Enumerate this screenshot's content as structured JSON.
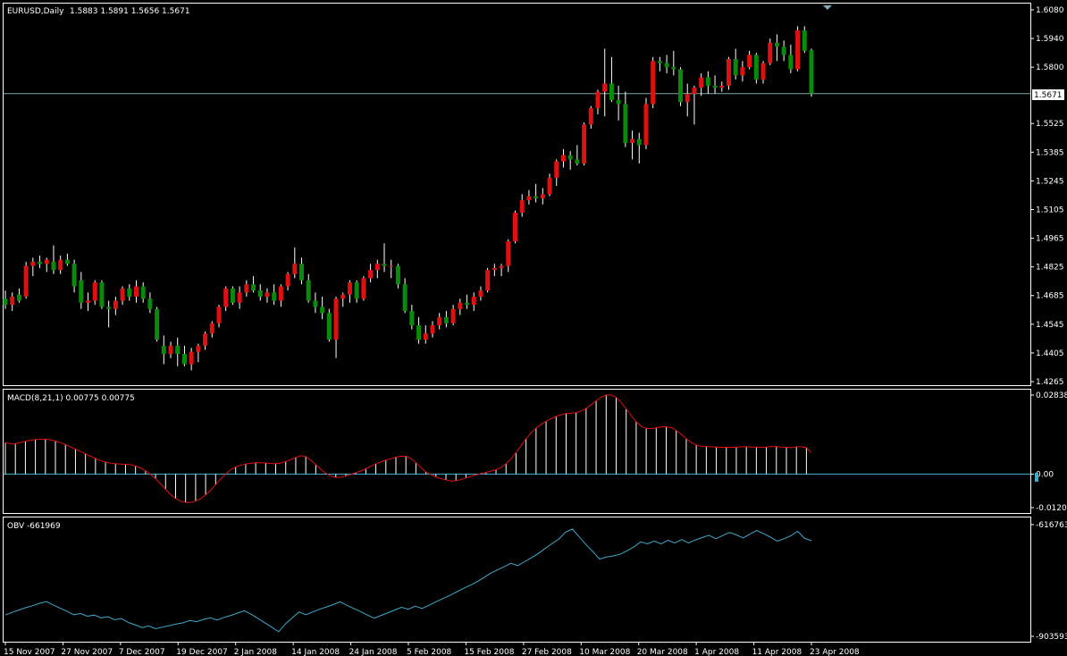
{
  "window": {
    "symbol_title": "EURUSD,Daily",
    "ohlc_readout": "1.5883 1.5891 1.5656 1.5671"
  },
  "colors": {
    "background": "#000000",
    "frame": "#ffffff",
    "bull_candle": "#0a8a0a",
    "bear_candle": "#e01010",
    "wick": "#ffffff",
    "price_line": "#7fa8a8",
    "macd_hist": "#ffffff",
    "macd_signal": "#e01010",
    "zero_line": "#3fa9c9",
    "obv_line": "#3fa9c9"
  },
  "price_panel": {
    "current_price_label": "1.5671",
    "y_ticks": [
      "1.6080",
      "1.5940",
      "1.5800",
      "1.5671",
      "1.5525",
      "1.5385",
      "1.5245",
      "1.5105",
      "1.4965",
      "1.4825",
      "1.4685",
      "1.4545",
      "1.4405",
      "1.4265"
    ]
  },
  "macd_panel": {
    "title": "MACD(8,21,1) 0.00775 0.00775",
    "y_ticks": [
      "0.02838",
      "0.00",
      "-0.01204"
    ]
  },
  "obv_panel": {
    "title": "OBV -661969",
    "y_ticks": [
      "-616763",
      "-903593"
    ]
  },
  "x_axis": {
    "labels": [
      "15 Nov 2007",
      "27 Nov 2007",
      "7 Dec 2007",
      "19 Dec 2007",
      "2 Jan 2008",
      "14 Jan 2008",
      "24 Jan 2008",
      "5 Feb 2008",
      "15 Feb 2008",
      "27 Feb 2008",
      "10 Mar 2008",
      "20 Mar 2008",
      "1 Apr 2008",
      "11 Apr 2008",
      "23 Apr 2008"
    ]
  },
  "chart_data": [
    {
      "type": "candlestick",
      "title": "EURUSD,Daily",
      "ylim": [
        1.4265,
        1.608
      ],
      "current_price": 1.5671,
      "candles": [
        [
          1.467,
          1.471,
          1.462,
          1.464
        ],
        [
          1.464,
          1.47,
          1.461,
          1.468
        ],
        [
          1.469,
          1.472,
          1.465,
          1.466
        ],
        [
          1.468,
          1.485,
          1.467,
          1.483
        ],
        [
          1.483,
          1.487,
          1.478,
          1.485
        ],
        [
          1.485,
          1.488,
          1.482,
          1.484
        ],
        [
          1.484,
          1.487,
          1.48,
          1.486
        ],
        [
          1.485,
          1.493,
          1.479,
          1.481
        ],
        [
          1.481,
          1.488,
          1.479,
          1.486
        ],
        [
          1.486,
          1.489,
          1.483,
          1.484
        ],
        [
          1.484,
          1.486,
          1.47,
          1.473
        ],
        [
          1.476,
          1.48,
          1.462,
          1.465
        ],
        [
          1.465,
          1.47,
          1.461,
          1.466
        ],
        [
          1.466,
          1.476,
          1.464,
          1.475
        ],
        [
          1.475,
          1.476,
          1.462,
          1.463
        ],
        [
          1.463,
          1.466,
          1.453,
          1.462
        ],
        [
          1.462,
          1.468,
          1.459,
          1.466
        ],
        [
          1.466,
          1.473,
          1.464,
          1.472
        ],
        [
          1.472,
          1.474,
          1.466,
          1.468
        ],
        [
          1.468,
          1.476,
          1.465,
          1.473
        ],
        [
          1.473,
          1.475,
          1.465,
          1.467
        ],
        [
          1.467,
          1.47,
          1.46,
          1.462
        ],
        [
          1.462,
          1.463,
          1.446,
          1.447
        ],
        [
          1.444,
          1.449,
          1.435,
          1.44
        ],
        [
          1.44,
          1.446,
          1.438,
          1.444
        ],
        [
          1.444,
          1.448,
          1.434,
          1.44
        ],
        [
          1.44,
          1.444,
          1.434,
          1.435
        ],
        [
          1.435,
          1.443,
          1.432,
          1.441
        ],
        [
          1.441,
          1.445,
          1.436,
          1.444
        ],
        [
          1.444,
          1.451,
          1.442,
          1.45
        ],
        [
          1.45,
          1.456,
          1.448,
          1.455
        ],
        [
          1.455,
          1.464,
          1.453,
          1.463
        ],
        [
          1.463,
          1.473,
          1.461,
          1.472
        ],
        [
          1.472,
          1.473,
          1.464,
          1.465
        ],
        [
          1.465,
          1.473,
          1.462,
          1.47
        ],
        [
          1.47,
          1.476,
          1.468,
          1.474
        ],
        [
          1.474,
          1.478,
          1.47,
          1.471
        ],
        [
          1.471,
          1.474,
          1.466,
          1.468
        ],
        [
          1.468,
          1.472,
          1.465,
          1.47
        ],
        [
          1.47,
          1.474,
          1.464,
          1.466
        ],
        [
          1.466,
          1.474,
          1.463,
          1.473
        ],
        [
          1.473,
          1.48,
          1.471,
          1.479
        ],
        [
          1.479,
          1.492,
          1.477,
          1.484
        ],
        [
          1.484,
          1.487,
          1.474,
          1.476
        ],
        [
          1.476,
          1.479,
          1.465,
          1.466
        ],
        [
          1.466,
          1.47,
          1.46,
          1.463
        ],
        [
          1.463,
          1.468,
          1.457,
          1.46
        ],
        [
          1.46,
          1.462,
          1.446,
          1.447
        ],
        [
          1.447,
          1.468,
          1.438,
          1.467
        ],
        [
          1.467,
          1.47,
          1.463,
          1.469
        ],
        [
          1.469,
          1.476,
          1.465,
          1.475
        ],
        [
          1.475,
          1.476,
          1.465,
          1.467
        ],
        [
          1.467,
          1.478,
          1.466,
          1.477
        ],
        [
          1.477,
          1.484,
          1.475,
          1.481
        ],
        [
          1.481,
          1.486,
          1.477,
          1.484
        ],
        [
          1.484,
          1.494,
          1.48,
          1.483
        ],
        [
          1.483,
          1.486,
          1.477,
          1.483
        ],
        [
          1.483,
          1.484,
          1.472,
          1.474
        ],
        [
          1.474,
          1.477,
          1.46,
          1.461
        ],
        [
          1.461,
          1.464,
          1.452,
          1.454
        ],
        [
          1.454,
          1.458,
          1.445,
          1.447
        ],
        [
          1.447,
          1.454,
          1.445,
          1.45
        ],
        [
          1.45,
          1.456,
          1.448,
          1.454
        ],
        [
          1.454,
          1.46,
          1.452,
          1.458
        ],
        [
          1.458,
          1.461,
          1.453,
          1.455
        ],
        [
          1.455,
          1.464,
          1.454,
          1.462
        ],
        [
          1.462,
          1.467,
          1.459,
          1.465
        ],
        [
          1.465,
          1.469,
          1.462,
          1.464
        ],
        [
          1.464,
          1.47,
          1.461,
          1.468
        ],
        [
          1.468,
          1.473,
          1.466,
          1.471
        ],
        [
          1.471,
          1.482,
          1.47,
          1.481
        ],
        [
          1.481,
          1.484,
          1.478,
          1.482
        ],
        [
          1.482,
          1.484,
          1.478,
          1.483
        ],
        [
          1.483,
          1.496,
          1.48,
          1.495
        ],
        [
          1.495,
          1.51,
          1.494,
          1.509
        ],
        [
          1.509,
          1.518,
          1.507,
          1.515
        ],
        [
          1.515,
          1.52,
          1.513,
          1.517
        ],
        [
          1.517,
          1.523,
          1.514,
          1.516
        ],
        [
          1.516,
          1.521,
          1.513,
          1.518
        ],
        [
          1.518,
          1.528,
          1.517,
          1.526
        ],
        [
          1.526,
          1.535,
          1.522,
          1.534
        ],
        [
          1.534,
          1.54,
          1.531,
          1.537
        ],
        [
          1.537,
          1.539,
          1.53,
          1.535
        ],
        [
          1.535,
          1.542,
          1.532,
          1.533
        ],
        [
          1.533,
          1.553,
          1.532,
          1.552
        ],
        [
          1.552,
          1.561,
          1.55,
          1.56
        ],
        [
          1.56,
          1.569,
          1.557,
          1.568
        ],
        [
          1.568,
          1.589,
          1.556,
          1.572
        ],
        [
          1.572,
          1.585,
          1.563,
          1.564
        ],
        [
          1.564,
          1.571,
          1.554,
          1.562
        ],
        [
          1.562,
          1.568,
          1.541,
          1.543
        ],
        [
          1.543,
          1.549,
          1.535,
          1.545
        ],
        [
          1.545,
          1.548,
          1.533,
          1.542
        ],
        [
          1.542,
          1.565,
          1.54,
          1.562
        ],
        [
          1.562,
          1.585,
          1.56,
          1.583
        ],
        [
          1.583,
          1.585,
          1.578,
          1.582
        ],
        [
          1.582,
          1.586,
          1.577,
          1.58
        ],
        [
          1.58,
          1.588,
          1.576,
          1.579
        ],
        [
          1.579,
          1.58,
          1.561,
          1.563
        ],
        [
          1.563,
          1.572,
          1.556,
          1.567
        ],
        [
          1.567,
          1.571,
          1.552,
          1.57
        ],
        [
          1.57,
          1.577,
          1.566,
          1.575
        ],
        [
          1.575,
          1.578,
          1.567,
          1.571
        ],
        [
          1.571,
          1.576,
          1.567,
          1.57
        ],
        [
          1.57,
          1.573,
          1.568,
          1.571
        ],
        [
          1.571,
          1.585,
          1.569,
          1.584
        ],
        [
          1.584,
          1.589,
          1.574,
          1.576
        ],
        [
          1.576,
          1.583,
          1.573,
          1.58
        ],
        [
          1.58,
          1.588,
          1.579,
          1.586
        ],
        [
          1.586,
          1.587,
          1.572,
          1.574
        ],
        [
          1.574,
          1.583,
          1.572,
          1.582
        ],
        [
          1.582,
          1.594,
          1.581,
          1.592
        ],
        [
          1.592,
          1.596,
          1.583,
          1.59
        ],
        [
          1.59,
          1.593,
          1.583,
          1.586
        ],
        [
          1.586,
          1.591,
          1.577,
          1.579
        ],
        [
          1.579,
          1.6,
          1.578,
          1.598
        ],
        [
          1.598,
          1.6,
          1.587,
          1.588
        ],
        [
          1.5883,
          1.5891,
          1.5656,
          1.5671
        ]
      ]
    },
    {
      "type": "bar",
      "title": "MACD(8,21,1) 0.00775 0.00775",
      "ylim": [
        -0.01204,
        0.02838
      ],
      "values": [
        0.0113,
        0.0109,
        0.011,
        0.0113,
        0.0118,
        0.0121,
        0.0124,
        0.0125,
        0.0125,
        0.0123,
        0.0119,
        0.0113,
        0.0106,
        0.0098,
        0.009,
        0.0081,
        0.0073,
        0.0064,
        0.0056,
        0.0049,
        0.0043,
        0.0039,
        0.0037,
        0.0036,
        0.0035,
        0.0034,
        0.0029,
        0.0022,
        0.0012,
        -0.0001,
        -0.0017,
        -0.0035,
        -0.0055,
        -0.0073,
        -0.0088,
        -0.0097,
        -0.0102,
        -0.0102,
        -0.0097,
        -0.0088,
        -0.0075,
        -0.0058,
        -0.0038,
        -0.0018,
        0.0001,
        0.0016,
        0.0026,
        0.0032,
        0.0036,
        0.0039,
        0.0041,
        0.0041,
        0.004,
        0.0038,
        0.0037,
        0.004,
        0.0045,
        0.0052,
        0.006,
        0.0066,
        0.0063,
        0.005,
        0.0034,
        0.0017,
        0.0003,
        -0.0007,
        -0.0012,
        -0.0011,
        -0.0007,
        -0.0001,
        0.0005,
        0.0011,
        0.0019,
        0.0028,
        0.0037,
        0.0044,
        0.005,
        0.0055,
        0.0061,
        0.0064,
        0.0064,
        0.0056,
        0.0041,
        0.0023,
        0.0008,
        -0.0002,
        -0.001,
        -0.0016,
        -0.0021,
        -0.0025,
        -0.0024,
        -0.002,
        -0.0014,
        -0.0008,
        -0.0003,
        0.0002,
        0.0006,
        0.0011,
        0.0016,
        0.0024,
        0.0037,
        0.0055,
        0.0077,
        0.0102,
        0.0127,
        0.0148,
        0.0165,
        0.0179,
        0.019,
        0.0199,
        0.0207,
        0.0213,
        0.0218,
        0.0219,
        0.0221,
        0.0226,
        0.0236,
        0.0249,
        0.0263,
        0.0276,
        0.0284,
        0.0284,
        0.0275,
        0.0257,
        0.0234,
        0.021,
        0.0188,
        0.0172,
        0.0164,
        0.0163,
        0.0166,
        0.0169,
        0.017,
        0.0167,
        0.0157,
        0.0143,
        0.0127,
        0.0113,
        0.0104,
        0.01,
        0.0099,
        0.0098,
        0.0097,
        0.0096,
        0.0096,
        0.0096,
        0.0096,
        0.0098,
        0.0098,
        0.0097,
        0.0097,
        0.0096,
        0.0097,
        0.0099,
        0.0099,
        0.0097,
        0.0096,
        0.0095,
        0.0098,
        0.0098,
        0.0095,
        0.0078
      ]
    },
    {
      "type": "line",
      "title": "OBV -661969",
      "ylim": [
        -903593,
        -616763
      ],
      "series": [
        {
          "values": [
            -849000,
            -842000,
            -836000,
            -830000,
            -825000,
            -819000,
            -814000,
            -823000,
            -831000,
            -839000,
            -848000,
            -845000,
            -852000,
            -849000,
            -856000,
            -853000,
            -861000,
            -858000,
            -868000,
            -874000,
            -881000,
            -877000,
            -884000,
            -880000,
            -876000,
            -872000,
            -869000,
            -863000,
            -866000,
            -860000,
            -856000,
            -862000,
            -855000,
            -850000,
            -844000,
            -838000,
            -847000,
            -858000,
            -869000,
            -880000,
            -892000,
            -872000,
            -856000,
            -841000,
            -848000,
            -841000,
            -834000,
            -828000,
            -822000,
            -815000,
            -824000,
            -832000,
            -840000,
            -849000,
            -857000,
            -850000,
            -843000,
            -836000,
            -829000,
            -834000,
            -826000,
            -832000,
            -824000,
            -815000,
            -807000,
            -799000,
            -790000,
            -781000,
            -773000,
            -764000,
            -753000,
            -742000,
            -733000,
            -725000,
            -716000,
            -722000,
            -712000,
            -702000,
            -691000,
            -678000,
            -666000,
            -654000,
            -636000,
            -628000,
            -648000,
            -668000,
            -686000,
            -705000,
            -700000,
            -697000,
            -693000,
            -684000,
            -674000,
            -661000,
            -666000,
            -659000,
            -666000,
            -657000,
            -664000,
            -655000,
            -664000,
            -656000,
            -650000,
            -644000,
            -653000,
            -645000,
            -637000,
            -643000,
            -651000,
            -641000,
            -632000,
            -640000,
            -649000,
            -659000,
            -653000,
            -645000,
            -634000,
            -652000,
            -658000
          ]
        }
      ]
    }
  ]
}
